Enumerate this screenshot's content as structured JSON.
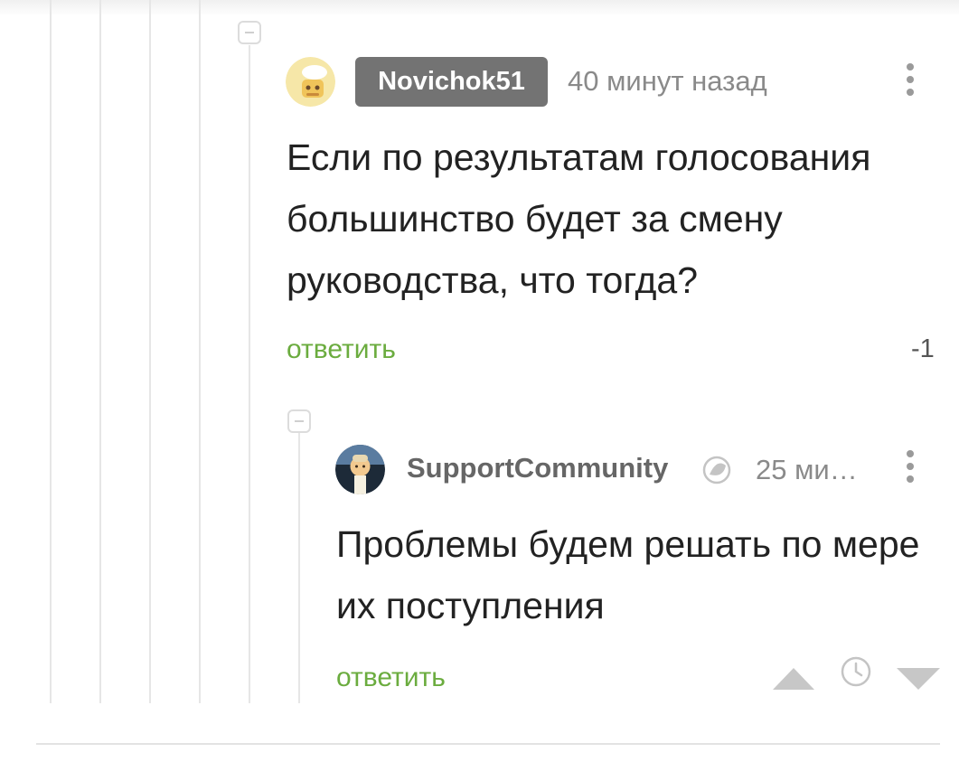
{
  "comment1": {
    "author": "Novichok51",
    "time": "40 минут назад",
    "text": "Если по результатам голосования большинство будет за смену руководства, что тогда?",
    "reply_label": "ответить",
    "rating": "-1"
  },
  "comment2": {
    "author": "SupportCommunity",
    "time": "25 ми…",
    "text": "Проблемы будем решать по мере их поступления",
    "reply_label": "ответить"
  },
  "icons": {
    "verified": "badge-icon",
    "vote_up": "triangle-up-icon",
    "save_later": "clock-icon",
    "vote_down": "triangle-down-icon",
    "menu": "kebab-icon"
  },
  "colors": {
    "reply_link": "#6bac3f",
    "nick_badge": "#737373",
    "meta_text": "#8a8a8a"
  }
}
